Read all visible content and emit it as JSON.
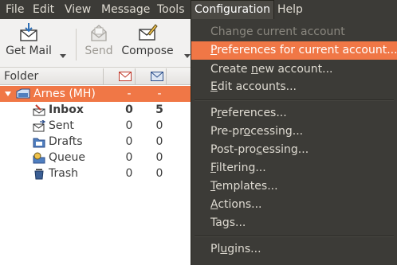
{
  "menubar": {
    "items": [
      "File",
      "Edit",
      "View",
      "Message",
      "Tools",
      "Configuration",
      "Help"
    ],
    "active": "Configuration"
  },
  "toolbar": {
    "get_mail": "Get Mail",
    "send": "Send",
    "compose": "Compose"
  },
  "folder_pane": {
    "header": "Folder",
    "header_icons": [
      "unread-mail-icon",
      "new-mail-icon"
    ],
    "account": {
      "name": "Arnes (MH)",
      "unread": "-",
      "new": "-"
    },
    "folders": [
      {
        "name": "Inbox",
        "unread": "0",
        "new": "5",
        "bold": true,
        "icon": "inbox-icon"
      },
      {
        "name": "Sent",
        "unread": "0",
        "new": "0",
        "icon": "sent-icon"
      },
      {
        "name": "Drafts",
        "unread": "0",
        "new": "0",
        "icon": "drafts-icon"
      },
      {
        "name": "Queue",
        "unread": "0",
        "new": "0",
        "icon": "queue-icon"
      },
      {
        "name": "Trash",
        "unread": "0",
        "new": "0",
        "icon": "trash-icon"
      }
    ]
  },
  "configuration_menu": {
    "items": [
      {
        "pre": "Change current account",
        "mn": "",
        "post": "",
        "state": "disabled"
      },
      {
        "pre": "",
        "mn": "P",
        "post": "references for current account...",
        "state": "hover"
      },
      {
        "pre": "Create ",
        "mn": "n",
        "post": "ew account...",
        "state": "normal"
      },
      {
        "pre": "",
        "mn": "E",
        "post": "dit accounts...",
        "state": "normal"
      },
      {
        "pre": "P",
        "mn": "r",
        "post": "eferences...",
        "state": "normal"
      },
      {
        "pre": "Pre-pr",
        "mn": "o",
        "post": "cessing...",
        "state": "normal"
      },
      {
        "pre": "Post-pro",
        "mn": "c",
        "post": "essing...",
        "state": "normal"
      },
      {
        "pre": "",
        "mn": "F",
        "post": "iltering...",
        "state": "normal"
      },
      {
        "pre": "",
        "mn": "T",
        "post": "emplates...",
        "state": "normal"
      },
      {
        "pre": "",
        "mn": "A",
        "post": "ctions...",
        "state": "normal"
      },
      {
        "pre": "Ta",
        "mn": "g",
        "post": "s...",
        "state": "normal"
      },
      {
        "pre": "Pl",
        "mn": "u",
        "post": "gins...",
        "state": "normal"
      }
    ]
  },
  "colors": {
    "accent": "#f07746",
    "menubar_bg": "#3c3b37",
    "menu_text": "#dfdbd2"
  }
}
